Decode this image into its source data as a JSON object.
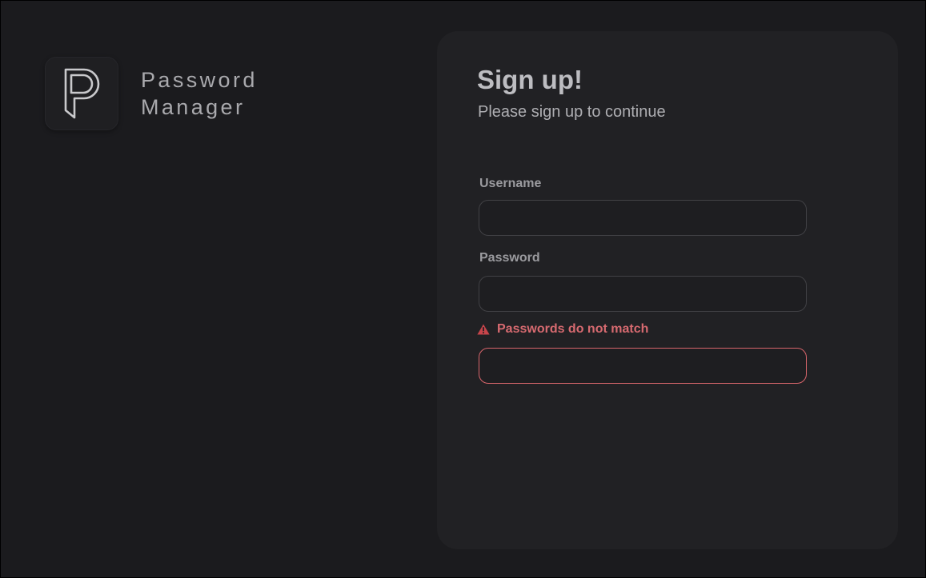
{
  "brand": {
    "name_line1": "Password",
    "name_line2": "Manager",
    "logo_icon": "stylized-p-logo-icon"
  },
  "form": {
    "title": "Sign up!",
    "subtitle": "Please sign up to continue",
    "username": {
      "label": "Username",
      "value": "",
      "placeholder": ""
    },
    "password": {
      "label": "Password",
      "value": "",
      "placeholder": ""
    },
    "confirm_password": {
      "error": "Passwords do not match",
      "error_icon": "warning-triangle-icon",
      "value": "",
      "placeholder": ""
    }
  },
  "colors": {
    "background": "#1b1b1e",
    "panel": "#212124",
    "error": "#d76a70",
    "error_border": "#d9666c"
  }
}
